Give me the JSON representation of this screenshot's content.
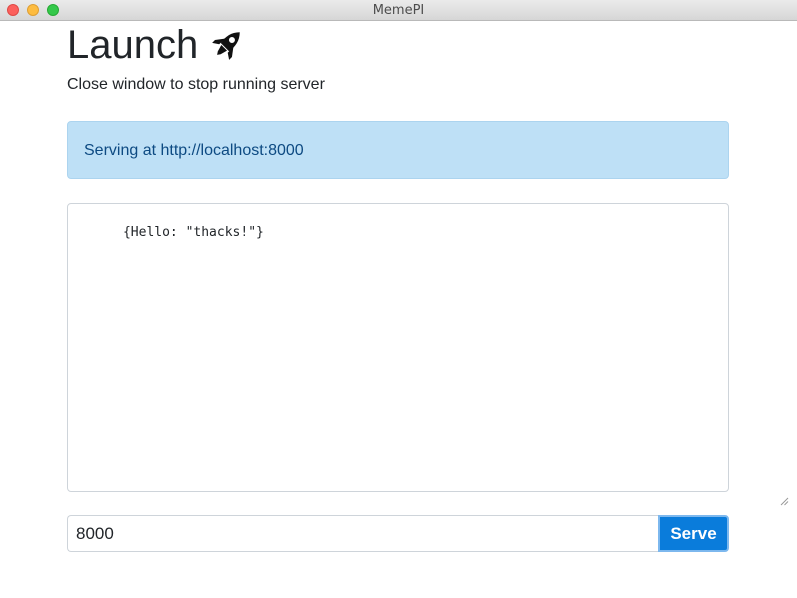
{
  "window": {
    "title": "MemePI"
  },
  "header": {
    "title": "Launch",
    "icon": "rocket-icon",
    "subtitle": "Close window to stop running server"
  },
  "status": {
    "message": "Serving at http://localhost:8000"
  },
  "editor": {
    "value": "{Hello: \"thacks!\"}"
  },
  "port": {
    "value": "8000",
    "button_label": "Serve"
  },
  "colors": {
    "alert_background": "#bee0f6",
    "alert_text": "#0d4a82",
    "button_background": "#0a7cdb"
  }
}
